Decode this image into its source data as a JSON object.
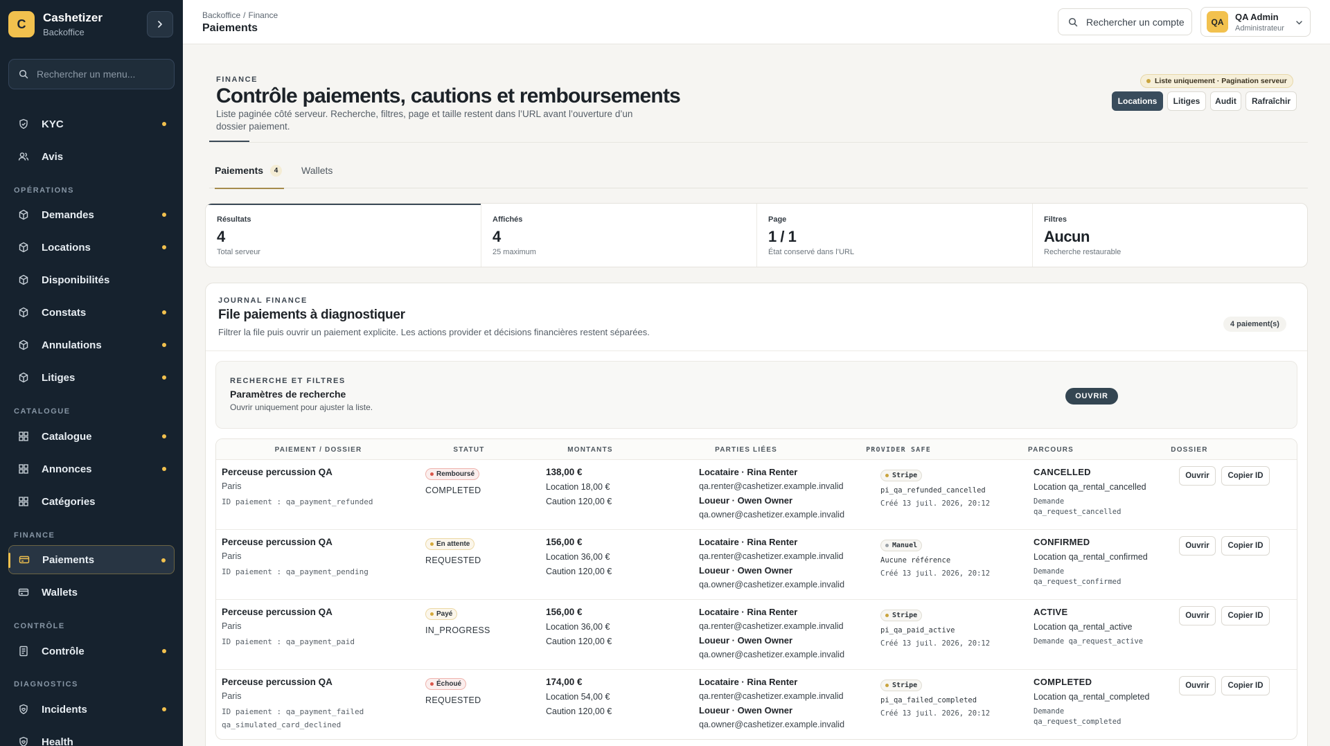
{
  "brand": {
    "logo": "C",
    "name": "Cashetizer",
    "sub": "Backoffice"
  },
  "sidebar": {
    "search_placeholder": "Rechercher un menu...",
    "sections": {
      "operations": "OPÉRATIONS",
      "catalogue": "CATALOGUE",
      "finance": "FINANCE",
      "controle": "CONTRÔLE",
      "diagnostics": "DIAGNOSTICS"
    },
    "items": {
      "kyc": "KYC",
      "avis": "Avis",
      "demandes": "Demandes",
      "locations": "Locations",
      "disponibilites": "Disponibilités",
      "constats": "Constats",
      "annulations": "Annulations",
      "litiges": "Litiges",
      "catalogue": "Catalogue",
      "annonces": "Annonces",
      "categories": "Catégories",
      "paiements": "Paiements",
      "wallets": "Wallets",
      "controle": "Contrôle",
      "incidents": "Incidents",
      "health": "Health"
    }
  },
  "topbar": {
    "crumb_root": "Backoffice",
    "crumb_sep": "/",
    "crumb_current": "Finance",
    "title": "Paiements",
    "search_label": "Rechercher un compte",
    "user_initials": "QA",
    "user_name": "QA Admin",
    "user_role": "Administrateur"
  },
  "header": {
    "eyebrow": "FINANCE",
    "title": "Contrôle paiements, cautions et remboursements",
    "description": "Liste paginée côté serveur. Recherche, filtres, page et taille restent dans l’URL avant l’ouverture d’un dossier paiement.",
    "info_badge": "Liste uniquement · Pagination serveur",
    "actions": {
      "locations": "Locations",
      "litiges": "Litiges",
      "audit": "Audit",
      "refresh": "Rafraîchir"
    }
  },
  "tabs": {
    "paiements": "Paiements",
    "paiements_count": "4",
    "wallets": "Wallets"
  },
  "stats": [
    {
      "label": "Résultats",
      "value": "4",
      "sub": "Total serveur"
    },
    {
      "label": "Affichés",
      "value": "4",
      "sub": "25 maximum"
    },
    {
      "label": "Page",
      "value": "1 / 1",
      "sub": "État conservé dans l’URL"
    },
    {
      "label": "Filtres",
      "value": "Aucun",
      "sub": "Recherche restaurable"
    }
  ],
  "journal": {
    "eyebrow": "JOURNAL FINANCE",
    "title": "File paiements à diagnostiquer",
    "description": "Filtrer la file puis ouvrir un paiement explicite. Les actions provider et décisions financières restent séparées.",
    "count": "4 paiement(s)"
  },
  "filters": {
    "eyebrow": "RECHERCHE ET FILTRES",
    "title": "Paramètres de recherche",
    "sub": "Ouvrir uniquement pour ajuster la liste.",
    "open_button": "OUVRIR"
  },
  "table": {
    "headers": {
      "payment": "PAIEMENT / DOSSIER",
      "status": "STATUT",
      "amounts": "MONTANTS",
      "parties": "PARTIES LIÉES",
      "provider": "PROVIDER SAFE",
      "route": "PARCOURS",
      "dossier": "DOSSIER"
    },
    "open_label": "Ouvrir",
    "copy_label": "Copier ID",
    "rows": [
      {
        "title": "Perceuse percussion QA",
        "city": "Paris",
        "id": "ID paiement : qa_payment_refunded",
        "id_extra": "",
        "status_label": "Remboursé",
        "status_code": "COMPLETED",
        "status_color": "#d9574b",
        "amount": "138,00 €",
        "location": "Location 18,00 €",
        "caution": "Caution 120,00 €",
        "renter": "Locataire · Rina Renter",
        "renter_mail": "qa.renter@cashetizer.example.invalid",
        "owner": "Loueur · Owen Owner",
        "owner_mail": "qa.owner@cashetizer.example.invalid",
        "provider": "Stripe",
        "provider_color": "#c9a43d",
        "provider_ref": "pi_qa_refunded_cancelled",
        "provider_date": "Créé 13 juil. 2026, 20:12",
        "route_state": "CANCELLED",
        "route_loc": "Location qa_rental_cancelled",
        "route_req": "Demande qa_request_cancelled"
      },
      {
        "title": "Perceuse percussion QA",
        "city": "Paris",
        "id": "ID paiement : qa_payment_pending",
        "id_extra": "",
        "status_label": "En attente",
        "status_code": "REQUESTED",
        "status_color": "#d4a93a",
        "amount": "156,00 €",
        "location": "Location 36,00 €",
        "caution": "Caution 120,00 €",
        "renter": "Locataire · Rina Renter",
        "renter_mail": "qa.renter@cashetizer.example.invalid",
        "owner": "Loueur · Owen Owner",
        "owner_mail": "qa.owner@cashetizer.example.invalid",
        "provider": "Manuel",
        "provider_color": "#9aa1a7",
        "provider_ref": "Aucune référence",
        "provider_date": "Créé 13 juil. 2026, 20:12",
        "route_state": "CONFIRMED",
        "route_loc": "Location qa_rental_confirmed",
        "route_req": "Demande qa_request_confirmed"
      },
      {
        "title": "Perceuse percussion QA",
        "city": "Paris",
        "id": "ID paiement : qa_payment_paid",
        "id_extra": "",
        "status_label": "Payé",
        "status_color": "#d4a93a",
        "status_code": "IN_PROGRESS",
        "amount": "156,00 €",
        "location": "Location 36,00 €",
        "caution": "Caution 120,00 €",
        "renter": "Locataire · Rina Renter",
        "renter_mail": "qa.renter@cashetizer.example.invalid",
        "owner": "Loueur · Owen Owner",
        "owner_mail": "qa.owner@cashetizer.example.invalid",
        "provider": "Stripe",
        "provider_color": "#c9a43d",
        "provider_ref": "pi_qa_paid_active",
        "provider_date": "Créé 13 juil. 2026, 20:12",
        "route_state": "ACTIVE",
        "route_loc": "Location qa_rental_active",
        "route_req": "Demande qa_request_active"
      },
      {
        "title": "Perceuse percussion QA",
        "city": "Paris",
        "id": "ID paiement : qa_payment_failed",
        "id_extra": "qa_simulated_card_declined",
        "status_label": "Échoué",
        "status_code": "REQUESTED",
        "status_color": "#d9574b",
        "amount": "174,00 €",
        "location": "Location 54,00 €",
        "caution": "Caution 120,00 €",
        "renter": "Locataire · Rina Renter",
        "renter_mail": "qa.renter@cashetizer.example.invalid",
        "owner": "Loueur · Owen Owner",
        "owner_mail": "qa.owner@cashetizer.example.invalid",
        "provider": "Stripe",
        "provider_color": "#c9a43d",
        "provider_ref": "pi_qa_failed_completed",
        "provider_date": "Créé 13 juil. 2026, 20:12",
        "route_state": "COMPLETED",
        "route_loc": "Location qa_rental_completed",
        "route_req": "Demande qa_request_completed"
      }
    ]
  }
}
